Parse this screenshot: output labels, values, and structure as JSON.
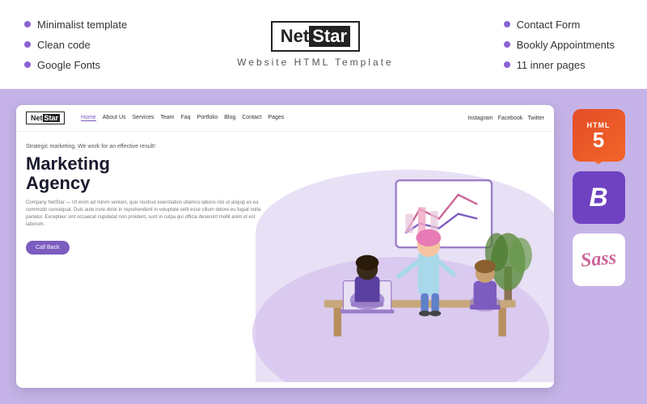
{
  "top": {
    "features_left": [
      "Minimalist template",
      "Clean code",
      "Google Fonts"
    ],
    "logo": {
      "net": "Net",
      "star": "Star",
      "subtitle": "Website HTML Template"
    },
    "features_right": [
      "Contact Form",
      "Bookly Appointments",
      "11 inner pages"
    ]
  },
  "preview": {
    "nav_links": [
      "Home",
      "About Us",
      "Services",
      "Team",
      "Faq",
      "Portfolio",
      "Blog",
      "Contact",
      "Pages"
    ],
    "social_links": [
      "Instagram",
      "Facebook",
      "Twitter"
    ],
    "tagline": "Strategic marketing. We work for an effective result!",
    "headline_line1": "Marketing",
    "headline_line2": "Agency",
    "body_text": "Company NetStar — Ut enim ad minim veniam, quis nostrud exercitation ullamco laboris nisi ut aliquip ex ea commodo consequat. Duis aute irure dolor in reprehenderit in voluptate velit esse cillum dolore eu fugiat nulla pariatur. Excepteur sint occaecat cupidatat non proident, sunt in culpa qui officia deserunt mollit anim id est laborum.",
    "cta_button": "Call Back"
  },
  "tech_icons": {
    "html_label": "HTML",
    "html_number": "5",
    "bootstrap_letter": "B",
    "sass_text": "Sass"
  }
}
